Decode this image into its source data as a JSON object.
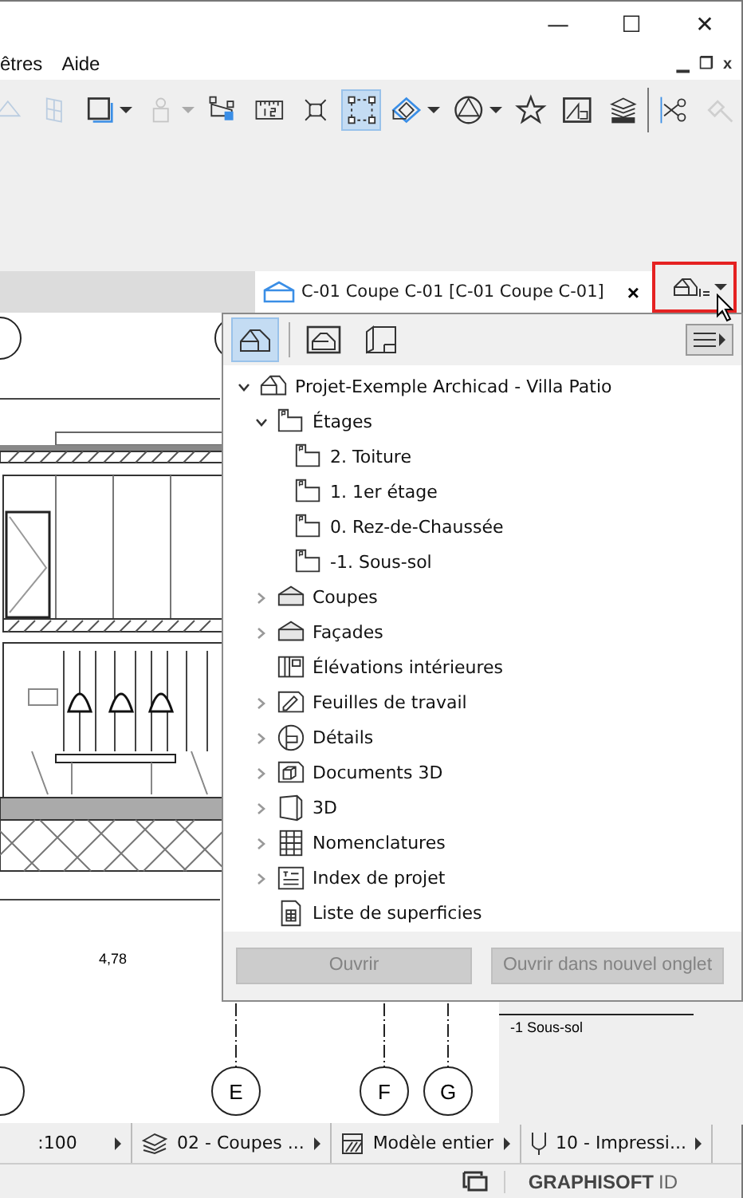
{
  "window": {
    "controls": [
      "—",
      "☐",
      "✕"
    ]
  },
  "menu": {
    "items": [
      "êtres",
      "Aide"
    ],
    "doc_controls": [
      "▁",
      "❐",
      "x"
    ]
  },
  "toolbar": [
    {
      "kind": "triangle",
      "disabled": true,
      "selected": false,
      "dropdown": false
    },
    {
      "kind": "grid",
      "disabled": true,
      "selected": false,
      "dropdown": false
    },
    {
      "kind": "frame",
      "disabled": false,
      "selected": false,
      "dropdown": true
    },
    {
      "kind": "figure",
      "disabled": true,
      "selected": false,
      "dropdown": true
    },
    {
      "kind": "fill",
      "disabled": false,
      "selected": false,
      "dropdown": false
    },
    {
      "kind": "ruler",
      "disabled": false,
      "selected": false,
      "dropdown": false
    },
    {
      "kind": "cross",
      "disabled": false,
      "selected": false,
      "dropdown": false
    },
    {
      "kind": "select",
      "disabled": false,
      "selected": true,
      "dropdown": false
    },
    {
      "kind": "box",
      "disabled": false,
      "selected": false,
      "dropdown": true
    },
    {
      "kind": "circle",
      "disabled": false,
      "selected": false,
      "dropdown": true
    },
    {
      "kind": "star",
      "disabled": false,
      "selected": false,
      "dropdown": false
    },
    {
      "kind": "elevation",
      "disabled": false,
      "selected": false,
      "dropdown": false
    },
    {
      "kind": "layers",
      "disabled": false,
      "selected": false,
      "dropdown": false
    },
    {
      "kind": "separator"
    },
    {
      "kind": "scissors",
      "disabled": false,
      "selected": false,
      "dropdown": false
    },
    {
      "kind": "wand",
      "disabled": true,
      "selected": false,
      "dropdown": false
    }
  ],
  "tab": {
    "title": "C-01 Coupe C-01 [C-01 Coupe C-01]",
    "close": "×"
  },
  "navigator": {
    "highlighted": true,
    "views": [
      {
        "kind": "project",
        "selected": true
      },
      {
        "kind": "layout",
        "selected": false
      },
      {
        "kind": "publisher",
        "selected": false
      }
    ],
    "tree": [
      {
        "label": "Projet-Exemple Archicad - Villa Patio",
        "kind": "project",
        "expanded": true,
        "selected": false,
        "children": [
          {
            "label": "Étages",
            "kind": "story",
            "expanded": true,
            "selected": false,
            "children": [
              {
                "label": "2. Toiture",
                "kind": "story",
                "selected": false
              },
              {
                "label": "1. 1er étage",
                "kind": "story",
                "selected": false
              },
              {
                "label": "0. Rez-de-Chaussée",
                "kind": "story",
                "selected": false
              },
              {
                "label": "-1. Sous-sol",
                "kind": "story",
                "selected": false
              }
            ]
          },
          {
            "label": "Coupes",
            "kind": "section",
            "expanded": false,
            "selected": false
          },
          {
            "label": "Façades",
            "kind": "section",
            "expanded": false,
            "selected": false
          },
          {
            "label": "Élévations intérieures",
            "kind": "interior",
            "selected": false
          },
          {
            "label": "Feuilles de travail",
            "kind": "worksheet",
            "expanded": false,
            "selected": false
          },
          {
            "label": "Détails",
            "kind": "detail",
            "expanded": false,
            "selected": false
          },
          {
            "label": "Documents 3D",
            "kind": "doc3d",
            "expanded": false,
            "selected": false
          },
          {
            "label": "3D",
            "kind": "view3d",
            "expanded": false,
            "selected": false
          },
          {
            "label": "Nomenclatures",
            "kind": "schedule",
            "expanded": false,
            "selected": false
          },
          {
            "label": "Index de projet",
            "kind": "index",
            "expanded": false,
            "selected": false
          },
          {
            "label": "Liste de superficies",
            "kind": "list",
            "selected": false
          }
        ]
      }
    ],
    "buttons": [
      {
        "label": "Ouvrir",
        "disabled": true
      },
      {
        "label": "Ouvrir dans nouvel onglet",
        "disabled": true
      }
    ]
  },
  "drawing": {
    "dimension": "4,78",
    "grid_labels": [
      "E",
      "F",
      "G"
    ],
    "level_label": "-1 Sous-sol"
  },
  "status_bar": [
    {
      "label": ":100",
      "kind": "scale"
    },
    {
      "label": "02 - Coupes ...",
      "kind": "layers"
    },
    {
      "label": "Modèle entier",
      "kind": "model"
    },
    {
      "label": "10 - Impressi...",
      "kind": "pen"
    }
  ],
  "footer": {
    "brand": "GRAPHISOFT",
    "brand_suffix": "ID"
  }
}
